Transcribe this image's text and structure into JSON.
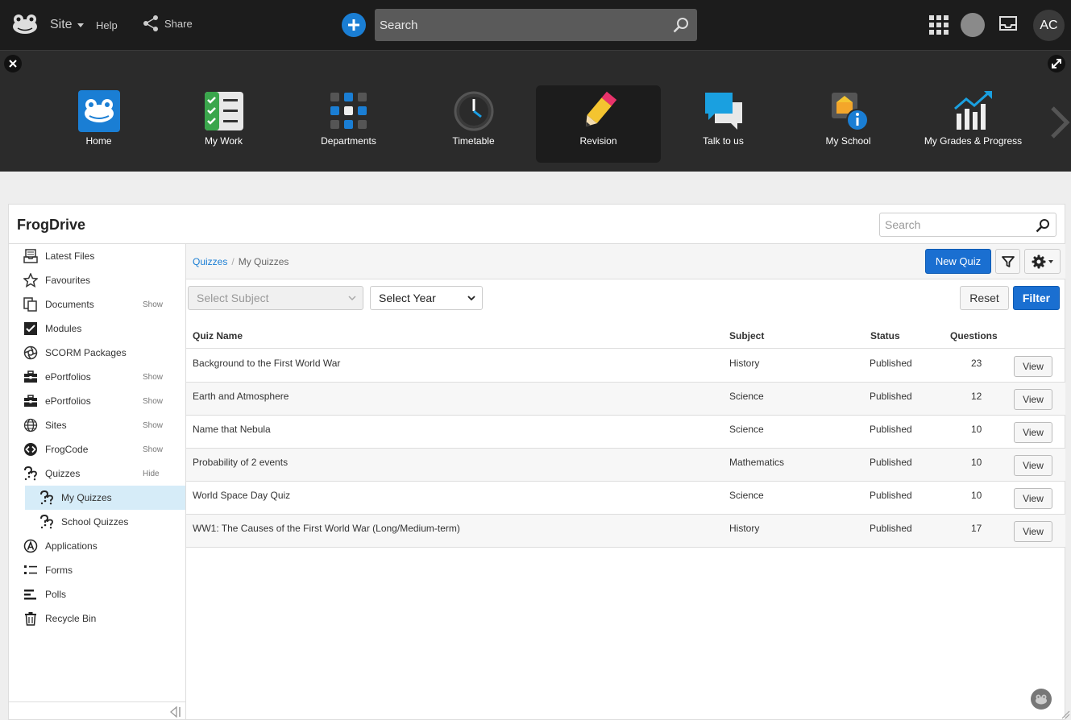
{
  "topbar": {
    "site_label": "Site",
    "help_label": "Help",
    "share_label": "Share",
    "search_placeholder": "Search",
    "avatar_initials": "AC"
  },
  "launcher": {
    "apps": [
      {
        "label": "Home",
        "icon": "frog-home-icon"
      },
      {
        "label": "My Work",
        "icon": "checklist-icon"
      },
      {
        "label": "Departments",
        "icon": "grid-icon"
      },
      {
        "label": "Timetable",
        "icon": "clock-icon"
      },
      {
        "label": "Revision",
        "icon": "pencil-icon",
        "active": true
      },
      {
        "label": "Talk to us",
        "icon": "chat-bubbles-icon"
      },
      {
        "label": "My School",
        "icon": "school-info-icon"
      },
      {
        "label": "My Grades & Progress",
        "icon": "bar-chart-trend-icon"
      }
    ]
  },
  "panel": {
    "title": "FrogDrive",
    "search_placeholder": "Search"
  },
  "sidebar": {
    "items": [
      {
        "label": "Latest Files",
        "icon": "inbox-tray-icon"
      },
      {
        "label": "Favourites",
        "icon": "star-icon"
      },
      {
        "label": "Documents",
        "icon": "documents-icon",
        "toggle": "Show"
      },
      {
        "label": "Modules",
        "icon": "checkbox-icon"
      },
      {
        "label": "SCORM Packages",
        "icon": "aperture-icon"
      },
      {
        "label": "ePortfolios",
        "icon": "briefcase-icon",
        "toggle": "Show"
      },
      {
        "label": "ePortfolios",
        "icon": "briefcase-icon",
        "toggle": "Show"
      },
      {
        "label": "Sites",
        "icon": "globe-icon",
        "toggle": "Show"
      },
      {
        "label": "FrogCode",
        "icon": "code-icon",
        "toggle": "Show"
      },
      {
        "label": "Quizzes",
        "icon": "quiz-icon",
        "toggle": "Hide"
      },
      {
        "label": "My Quizzes",
        "icon": "quiz-icon",
        "sub": true,
        "selected": true
      },
      {
        "label": "School Quizzes",
        "icon": "quiz-icon",
        "sub": true
      },
      {
        "label": "Applications",
        "icon": "applications-icon"
      },
      {
        "label": "Forms",
        "icon": "forms-icon"
      },
      {
        "label": "Polls",
        "icon": "polls-icon"
      },
      {
        "label": "Recycle Bin",
        "icon": "trash-icon"
      }
    ]
  },
  "main": {
    "breadcrumb": {
      "root": "Quizzes",
      "separator": "/",
      "current": "My Quizzes"
    },
    "new_quiz_label": "New Quiz",
    "filters": {
      "subject_placeholder": "Select Subject",
      "year_placeholder": "Select Year",
      "reset_label": "Reset",
      "filter_label": "Filter"
    },
    "table": {
      "headers": {
        "name": "Quiz Name",
        "subject": "Subject",
        "status": "Status",
        "questions": "Questions"
      },
      "view_label": "View",
      "rows": [
        {
          "name": "Background to the First World War",
          "subject": "History",
          "status": "Published",
          "questions": "23"
        },
        {
          "name": "Earth and Atmosphere",
          "subject": "Science",
          "status": "Published",
          "questions": "12"
        },
        {
          "name": "Name that Nebula",
          "subject": "Science",
          "status": "Published",
          "questions": "10"
        },
        {
          "name": "Probability of 2 events",
          "subject": "Mathematics",
          "status": "Published",
          "questions": "10"
        },
        {
          "name": "World Space Day Quiz",
          "subject": "Science",
          "status": "Published",
          "questions": "10"
        },
        {
          "name": "WW1: The Causes of the First World War (Long/Medium-term)",
          "subject": "History",
          "status": "Published",
          "questions": "17"
        }
      ]
    }
  },
  "colors": {
    "topbar_bg": "#1c1c1c",
    "launcher_bg": "#2b2b2b",
    "primary_blue": "#1a6fd1",
    "link_blue": "#1a7ed4",
    "selected_row": "#d6ecf8"
  }
}
